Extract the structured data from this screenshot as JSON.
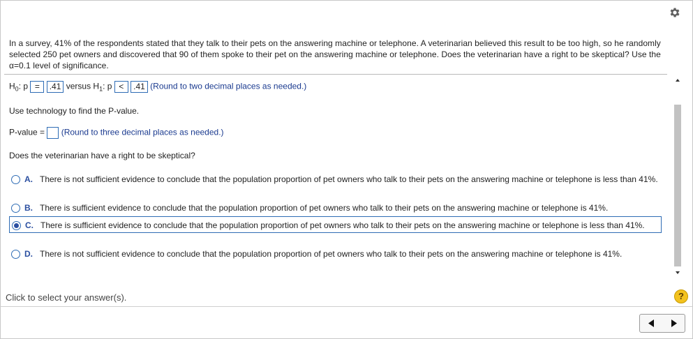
{
  "problem": {
    "text": "In a survey, 41% of the respondents stated that they talk to their pets on the answering machine or telephone. A veterinarian believed this result to be too high, so he randomly selected 250 pet owners and discovered that 90 of them spoke to their pet on the answering machine or telephone. Does the veterinarian have a right to be skeptical? Use the α=0.1 level of significance."
  },
  "hypotheses": {
    "h0_prefix": "H",
    "h0_sub": "0",
    "h0_colon": ": p",
    "h0_operator": "=",
    "h0_value": ".41",
    "versus": "versus H",
    "h1_sub": "1",
    "h1_colon": ": p",
    "h1_operator": "<",
    "h1_value": ".41",
    "hint": "(Round to two decimal places as needed.)"
  },
  "pvalue_section": {
    "instruction": "Use technology to find the P-value.",
    "label": "P-value =",
    "value": "",
    "hint": "(Round to three decimal places as needed.)"
  },
  "question": "Does the veterinarian have a right to be skeptical?",
  "options": [
    {
      "letter": "A.",
      "text": "There is not sufficient evidence to conclude that the population proportion of pet owners who talk to their pets on the answering machine or telephone is less than 41%.",
      "selected": false
    },
    {
      "letter": "B.",
      "text": "There is sufficient evidence to conclude that the population proportion of pet owners who talk to their pets on the answering machine or telephone is 41%.",
      "selected": false
    },
    {
      "letter": "C.",
      "text": "There is sufficient evidence to conclude that the population proportion of pet owners who talk to their pets on the answering machine or telephone is less than 41%.",
      "selected": true
    },
    {
      "letter": "D.",
      "text": "There is not sufficient evidence to conclude that the population proportion of pet owners who talk to their pets on the answering machine or telephone is 41%.",
      "selected": false
    }
  ],
  "footer": {
    "status": "Click to select your answer(s).",
    "help_label": "?"
  },
  "colors": {
    "accent": "#2e6cb5",
    "hint_text": "#1a3a8f",
    "help_badge": "#f3c21f"
  }
}
